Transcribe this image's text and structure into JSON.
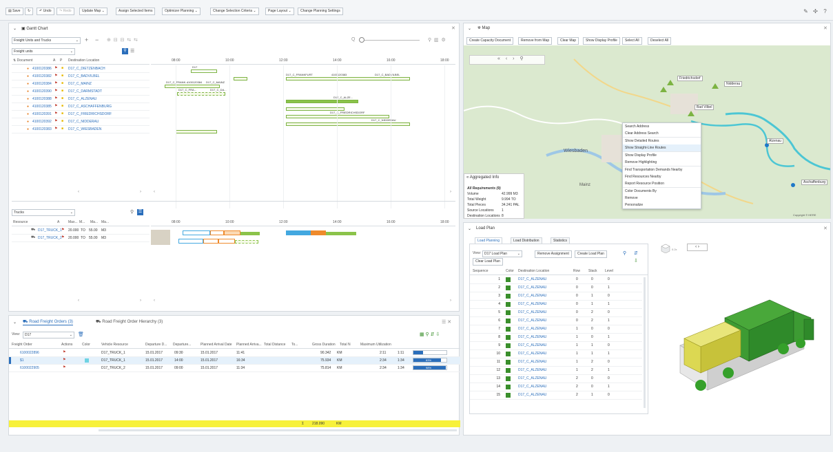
{
  "toolbar": {
    "save": "Save",
    "undo": "Undo",
    "redo": "Redo",
    "update_map": "Update Map",
    "assign_selected_items": "Assign Selected Items",
    "optimizer_planning": "Optimizer Planning",
    "change_selection_criteria": "Change Selection Criteria",
    "page_layout": "Page Layout",
    "change_planning_settings": "Change Planning Settings"
  },
  "gantt": {
    "title": "Gantt Chart",
    "view_select": "Freight Units and Trucks",
    "sub_select": "Freight units",
    "col_document": "Document",
    "col_a": "A",
    "col_p": "P",
    "col_dest": "Destination Location",
    "time_labels": [
      "08:00",
      "10:00",
      "12:00",
      "14:00",
      "16:00",
      "18:00"
    ],
    "rows": [
      {
        "doc": "4100120386",
        "dest": "D17_C_DIETZENBACH"
      },
      {
        "doc": "4100120382",
        "dest": "D17_C_BADVILBEL"
      },
      {
        "doc": "4100120384",
        "dest": "D17_C_MAINZ"
      },
      {
        "doc": "4100120390",
        "dest": "D17_C_DARMSTADT"
      },
      {
        "doc": "4100120388",
        "dest": "D17_C_ALZENAU"
      },
      {
        "doc": "4100120385",
        "dest": "D17_C_ASCHAFFENBURG"
      },
      {
        "doc": "4100120391",
        "dest": "D17_C_FRIEDRICHSDORF"
      },
      {
        "doc": "4100120392",
        "dest": "D17_C_NIDDERAU"
      },
      {
        "doc": "4100120383",
        "dest": "D17_C_WIESBADEN"
      }
    ],
    "bar_labels": [
      "D17_C_FRANKFURT",
      "4100120383",
      "D17_C_BADVILBEL",
      "D17_C_FRANK...",
      "4100120384",
      "D17_C_MAINZ",
      "D17_C_FRA...",
      "D17_C_DA...",
      "D17_C_ALZE...",
      "D17_C_FRIEDRICHSDORF",
      "D17_C_NIDDERAU",
      "D17"
    ],
    "trucks_select": "Trucks",
    "truck_cols": [
      "Resource",
      "A",
      "Max...",
      "M...",
      "Ma...",
      "Ma..."
    ],
    "trucks": [
      {
        "name": "D17_TRUCK_1",
        "max": "20.000",
        "unit": "TO",
        "vol": "55.00",
        "vunit": "M3"
      },
      {
        "name": "D17_TRUCK_2",
        "max": "20.000",
        "unit": "TO",
        "vol": "55.00",
        "vunit": "M3"
      }
    ]
  },
  "orders": {
    "tab1": "Road Freight Orders (3)",
    "tab2": "Road Freight Order Hierarchy (3)",
    "view_label": "View:",
    "view_value": "D17",
    "cols": [
      "Freight Order",
      "Actions",
      "Color",
      "Vehicle Resource",
      "Departure D...",
      "Departure...",
      "Planned Arrival Date",
      "Planned Arriva...",
      "Total Distance",
      "To...",
      "Gross Duration",
      "Total N",
      "Maximum Utilization"
    ],
    "rows": [
      {
        "fo": "6100022896",
        "vehicle": "D17_TRUCK_1",
        "dep_date": "15.01.2017",
        "dep_time": "09:30",
        "arr_date": "15.01.2017",
        "arr_time": "11:41",
        "dist": "90.342",
        "unit": "KM",
        "gross": "2:11",
        "net": "1:11",
        "util": "30%",
        "util_val": 30
      },
      {
        "fo": "$1",
        "vehicle": "D17_TRUCK_1",
        "dep_date": "15.01.2017",
        "dep_time": "14:00",
        "arr_date": "15.01.2017",
        "arr_time": "16:34",
        "dist": "75.934",
        "unit": "KM",
        "gross": "2:34",
        "net": "1:34",
        "util": "83%",
        "util_val": 83
      },
      {
        "fo": "6100022905",
        "vehicle": "D17_TRUCK_2",
        "dep_date": "15.01.2017",
        "dep_time": "09:00",
        "arr_date": "15.01.2017",
        "arr_time": "11:34",
        "dist": "75.814",
        "unit": "KM",
        "gross": "2:34",
        "net": "1:34",
        "util": "98%",
        "util_val": 98
      }
    ],
    "sum_symbol": "Σ",
    "sum_total": "218.090",
    "sum_unit": "KM"
  },
  "map": {
    "title": "Map",
    "buttons": [
      "Create Capacity Document",
      "Remove from Map",
      "Clear Map",
      "Show Display Profile",
      "Select All",
      "Deselect All"
    ],
    "cities": [
      "Friedrichsdorf",
      "Nidderau",
      "Bad Vilbel",
      "Alzenau",
      "Wiesbaden",
      "Aschaffenburg",
      "Mainz"
    ],
    "context_menu": [
      "Search Address",
      "Clear Address Search",
      "Show Detailed Routes",
      "Show Straight-Line Routes",
      "Show Display Profile",
      "Remove Highlighting",
      "Find Transportation Demands Nearby",
      "Find Resources Nearby",
      "Report Resource Position",
      "Color Documents By",
      "Remove",
      "Personalize"
    ],
    "agg_title": "Aggregated Info",
    "agg_sub": "All Requirements (9)",
    "agg_rows": [
      {
        "k": "Volume",
        "v": "42.999 M3"
      },
      {
        "k": "Total Weight",
        "v": "9.994 TO"
      },
      {
        "k": "Total Pieces",
        "v": "34.241 PAL"
      },
      {
        "k": "Source Locations",
        "v": "1"
      },
      {
        "k": "Destination Locations",
        "v": "8"
      }
    ],
    "copyright": "Copyright © HERE"
  },
  "load_plan": {
    "title": "Load Plan",
    "tabs": [
      "Load Planning",
      "Load Distribution",
      "Statistics"
    ],
    "view_label": "View:",
    "view_value": "D17 Load Plan",
    "remove_assignment": "Remove Assignment",
    "create_load_plan": "Create Load Plan",
    "clear_load_plan": "Clear Load Plan",
    "cols": [
      "Sequence",
      "Color",
      "Destination Location",
      "Row",
      "Stack",
      "Level"
    ],
    "rows": [
      {
        "seq": "1",
        "dest": "D17_C_ALZENAU",
        "row": "0",
        "stack": "0",
        "level": "0"
      },
      {
        "seq": "2",
        "dest": "D17_C_ALZENAU",
        "row": "0",
        "stack": "0",
        "level": "1"
      },
      {
        "seq": "3",
        "dest": "D17_C_ALZENAU",
        "row": "0",
        "stack": "1",
        "level": "0"
      },
      {
        "seq": "4",
        "dest": "D17_C_ALZENAU",
        "row": "0",
        "stack": "1",
        "level": "1"
      },
      {
        "seq": "5",
        "dest": "D17_C_ALZENAU",
        "row": "0",
        "stack": "2",
        "level": "0"
      },
      {
        "seq": "6",
        "dest": "D17_C_ALZENAU",
        "row": "0",
        "stack": "2",
        "level": "1"
      },
      {
        "seq": "7",
        "dest": "D17_C_ALZENAU",
        "row": "1",
        "stack": "0",
        "level": "0"
      },
      {
        "seq": "8",
        "dest": "D17_C_ALZENAU",
        "row": "1",
        "stack": "0",
        "level": "1"
      },
      {
        "seq": "9",
        "dest": "D17_C_ALZENAU",
        "row": "1",
        "stack": "1",
        "level": "0"
      },
      {
        "seq": "10",
        "dest": "D17_C_ALZENAU",
        "row": "1",
        "stack": "1",
        "level": "1"
      },
      {
        "seq": "11",
        "dest": "D17_C_ALZENAU",
        "row": "1",
        "stack": "2",
        "level": "0"
      },
      {
        "seq": "12",
        "dest": "D17_C_ALZENAU",
        "row": "1",
        "stack": "2",
        "level": "1"
      },
      {
        "seq": "13",
        "dest": "D17_C_ALZENAU",
        "row": "2",
        "stack": "0",
        "level": "0"
      },
      {
        "seq": "14",
        "dest": "D17_C_ALZENAU",
        "row": "2",
        "stack": "0",
        "level": "1"
      },
      {
        "seq": "15",
        "dest": "D17_C_ALZENAU",
        "row": "2",
        "stack": "1",
        "level": "0"
      }
    ],
    "view3d_label": "0.2x"
  },
  "colors": {
    "accent": "#2a6ebb",
    "bar_green": "#8bc34a",
    "bar_orange": "#ef8a2c",
    "bar_blue": "#43a8e0",
    "box_green": "#3a8f2c",
    "box_yellow": "#e4e067",
    "sum_yellow": "#f7f13a"
  }
}
